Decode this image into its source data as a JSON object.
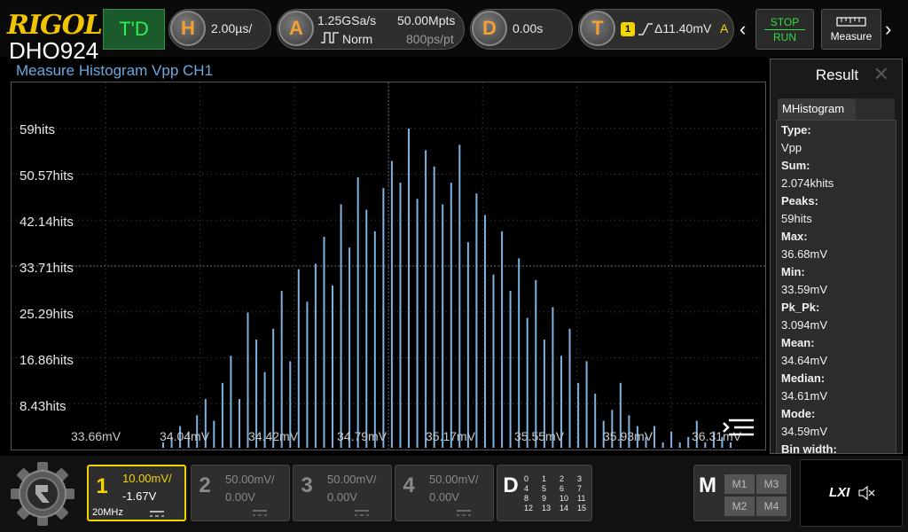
{
  "topbar": {
    "brand": "RIGOL",
    "model": "DHO924",
    "td_label": "T'D",
    "horizontal": {
      "icon": "H",
      "value": "2.00µs/"
    },
    "acquire": {
      "icon": "A",
      "sample_rate": "1.25GSa/s",
      "mode": "Norm",
      "depth": "50.00Mpts",
      "points": "800ps/pt"
    },
    "delay": {
      "icon": "D",
      "value": "0.00s"
    },
    "trigger": {
      "icon": "T",
      "channel": "1",
      "level": "Δ11.40mV",
      "coupling": "A"
    },
    "stop_label": "STOP",
    "run_label": "RUN",
    "measure_label": "Measure"
  },
  "plot": {
    "title": "Measure Histogram  Vpp  CH1",
    "y_labels": [
      "59hits",
      "50.57hits",
      "42.14hits",
      "33.71hits",
      "25.29hits",
      "16.86hits",
      "8.43hits"
    ],
    "x_labels": [
      "33.66mV",
      "34.04mV",
      "34.42mV",
      "34.79mV",
      "35.17mV",
      "35.55mV",
      "35.93mV",
      "36.31mV"
    ]
  },
  "chart_data": {
    "type": "bar",
    "x_start": 33.59,
    "x_end": 36.68,
    "y_max": 59,
    "bar_color": "#7fb2e0",
    "values": [
      1,
      2,
      4,
      3,
      6,
      9,
      5,
      12,
      17,
      9,
      25,
      20,
      14,
      22,
      29,
      16,
      33,
      27,
      34,
      39,
      30,
      45,
      37,
      50,
      44,
      40,
      48,
      53,
      49,
      59,
      46,
      55,
      52,
      45,
      49,
      56,
      38,
      47,
      43,
      32,
      40,
      29,
      35,
      24,
      31,
      20,
      26,
      17,
      22,
      12,
      16,
      10,
      5,
      7,
      12,
      6,
      4,
      2,
      4,
      1,
      3,
      1,
      2,
      5,
      1,
      3,
      2,
      1
    ]
  },
  "result": {
    "title": "Result",
    "tab": "MHistogram",
    "rows": [
      {
        "label": "Type:",
        "value": "Vpp"
      },
      {
        "label": "Sum:",
        "value": "2.074khits"
      },
      {
        "label": "Peaks:",
        "value": "59hits"
      },
      {
        "label": "Max:",
        "value": "36.68mV"
      },
      {
        "label": "Min:",
        "value": "33.59mV"
      },
      {
        "label": "Pk_Pk:",
        "value": "3.094mV"
      },
      {
        "label": "Mean:",
        "value": "34.64mV"
      },
      {
        "label": "Median:",
        "value": "34.61mV"
      },
      {
        "label": "Mode:",
        "value": "34.59mV"
      },
      {
        "label": "Bin width:",
        "value": ""
      }
    ]
  },
  "channels": [
    {
      "num": "1",
      "scale": "10.00mV/",
      "offset": "-1.67V",
      "bw": "20MHz",
      "active": true,
      "color": "#f2d400"
    },
    {
      "num": "2",
      "scale": "50.00mV/",
      "offset": "0.00V",
      "bw": "",
      "active": false,
      "color": "#888888"
    },
    {
      "num": "3",
      "scale": "50.00mV/",
      "offset": "0.00V",
      "bw": "",
      "active": false,
      "color": "#888888"
    },
    {
      "num": "4",
      "scale": "50.00mV/",
      "offset": "0.00V",
      "bw": "",
      "active": false,
      "color": "#888888"
    }
  ],
  "digital": {
    "label": "D",
    "bits": [
      "0",
      "1",
      "2",
      "3",
      "4",
      "5",
      "6",
      "7",
      "8",
      "9",
      "10",
      "11",
      "12",
      "13",
      "14",
      "15"
    ]
  },
  "math": {
    "label": "M",
    "items": [
      "M1",
      "M3",
      "M2",
      "M4"
    ]
  },
  "lxi_label": "LXI",
  "colors": {
    "accent_yellow": "#f2d400",
    "plot_title": "#6aa8e0",
    "run_green": "#33dd44"
  }
}
